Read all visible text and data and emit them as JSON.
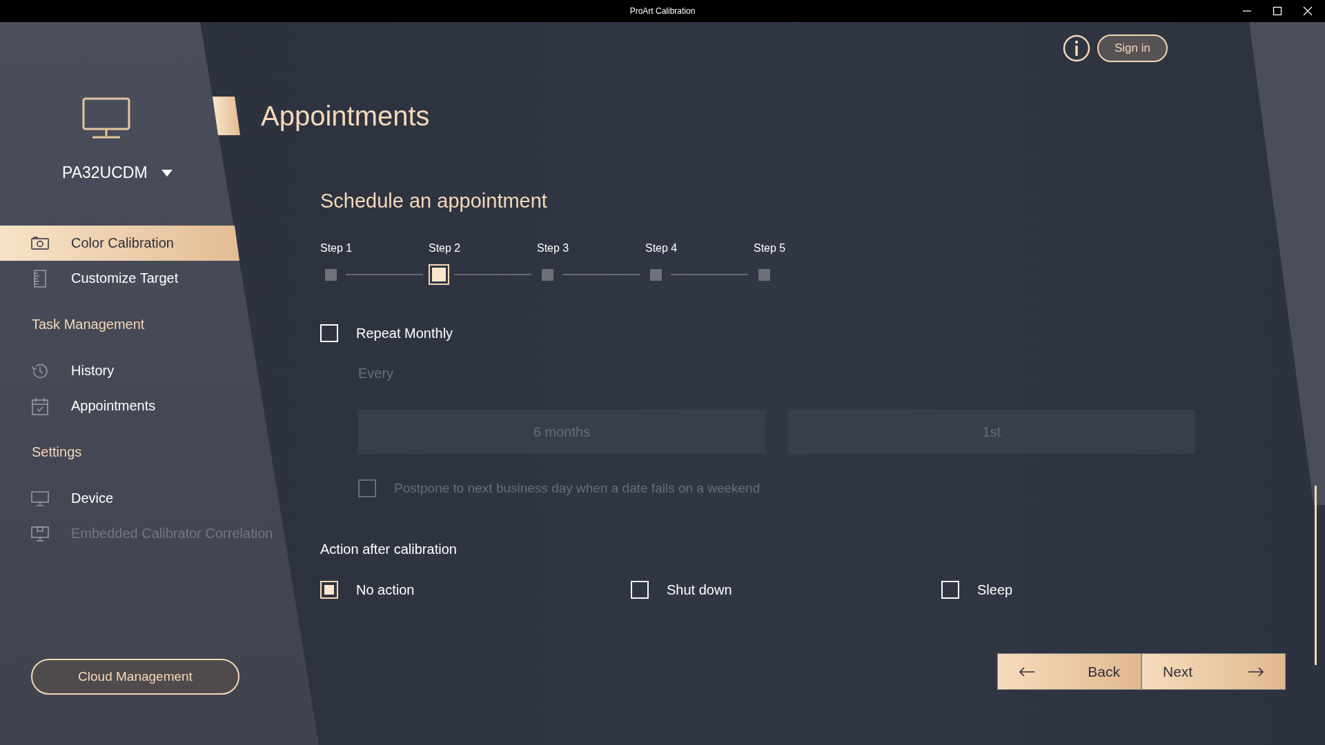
{
  "window": {
    "title": "ProArt Calibration"
  },
  "device": {
    "name": "PA32UCDM"
  },
  "sidebar": {
    "items": [
      {
        "kind": "item",
        "label": "Color Calibration",
        "selected": true,
        "disabled": false
      },
      {
        "kind": "item",
        "label": "Customize Target",
        "selected": false,
        "disabled": false
      },
      {
        "kind": "header",
        "label": "Task Management"
      },
      {
        "kind": "item",
        "label": "History",
        "selected": false,
        "disabled": false
      },
      {
        "kind": "item",
        "label": "Appointments",
        "selected": false,
        "disabled": false
      },
      {
        "kind": "header",
        "label": "Settings"
      },
      {
        "kind": "item",
        "label": "Device",
        "selected": false,
        "disabled": false
      },
      {
        "kind": "item",
        "label": "Embedded Calibrator Correlation",
        "selected": false,
        "disabled": true
      }
    ],
    "cloud_button": "Cloud Management"
  },
  "header": {
    "sign_in": "Sign in"
  },
  "page": {
    "title": "Appointments",
    "section_title": "Schedule an appointment"
  },
  "steps": [
    {
      "label": "Step 1",
      "selected": false
    },
    {
      "label": "Step 2",
      "selected": true
    },
    {
      "label": "Step 3",
      "selected": false
    },
    {
      "label": "Step 4",
      "selected": false
    },
    {
      "label": "Step 5",
      "selected": false
    }
  ],
  "repeat": {
    "label": "Repeat Monthly",
    "checked": false,
    "every_label": "Every",
    "disabled": true,
    "dropdowns": [
      {
        "value": "6 months"
      },
      {
        "value": "1st"
      }
    ],
    "postpone": {
      "label": "Postpone to next business day when a date falls on a weekend",
      "checked": false
    }
  },
  "action": {
    "title": "Action after calibration",
    "options": [
      {
        "label": "No action",
        "selected": true
      },
      {
        "label": "Shut down",
        "selected": false
      },
      {
        "label": "Sleep",
        "selected": false
      }
    ]
  },
  "buttons": {
    "back": "Back",
    "next": "Next"
  }
}
